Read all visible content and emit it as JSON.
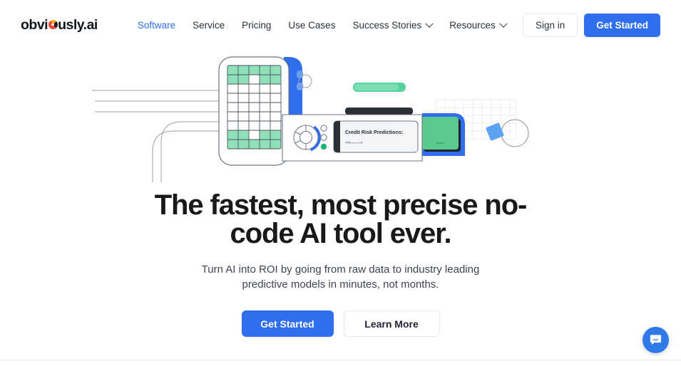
{
  "brand": {
    "name_before": "obvi",
    "name_after": "usly.ai",
    "logo_mark_icon": "pie-dot-icon",
    "accent_blue": "#2f6fed",
    "accent_green": "#56d39a",
    "text_dark": "#18191b"
  },
  "nav": {
    "links": [
      {
        "label": "Software",
        "active": true,
        "has_caret": false
      },
      {
        "label": "Service",
        "active": false,
        "has_caret": false
      },
      {
        "label": "Pricing",
        "active": false,
        "has_caret": false
      },
      {
        "label": "Use Cases",
        "active": false,
        "has_caret": false
      },
      {
        "label": "Success Stories",
        "active": false,
        "has_caret": true
      },
      {
        "label": "Resources",
        "active": false,
        "has_caret": true
      }
    ],
    "sign_in_label": "Sign in",
    "get_started_label": "Get Started"
  },
  "hero": {
    "title": "The fastest, most precise no-code AI tool ever.",
    "subtitle": "Turn AI into ROI by going from raw data to industry leading predictive models in minutes, not months.",
    "primary_cta": "Get Started",
    "secondary_cta": "Learn More"
  },
  "illustration": {
    "card_title": "Credit Risk Predictions:",
    "card_subtitle": "Phased",
    "grid": {
      "columns": 5,
      "rows": 8,
      "filled_color": "#8fe0b8",
      "pattern": [
        [
          1,
          1,
          1,
          1,
          1
        ],
        [
          1,
          1,
          0,
          1,
          1
        ],
        [
          0,
          0,
          0,
          0,
          0
        ],
        [
          0,
          0,
          0,
          0,
          0
        ],
        [
          0,
          0,
          0,
          0,
          0
        ],
        [
          0,
          0,
          0,
          0,
          0
        ],
        [
          1,
          1,
          0,
          1,
          1
        ],
        [
          1,
          1,
          1,
          1,
          1
        ]
      ]
    },
    "dial_indicator_dots": [
      "hollow",
      "hollow",
      "green"
    ],
    "cable_lines": 3,
    "cable_curves": 2,
    "decor_squares": 2,
    "decor_circle": 1
  },
  "chat": {
    "launcher_icon": "chat-bubble-icon",
    "launcher_color": "#2f79e8"
  }
}
